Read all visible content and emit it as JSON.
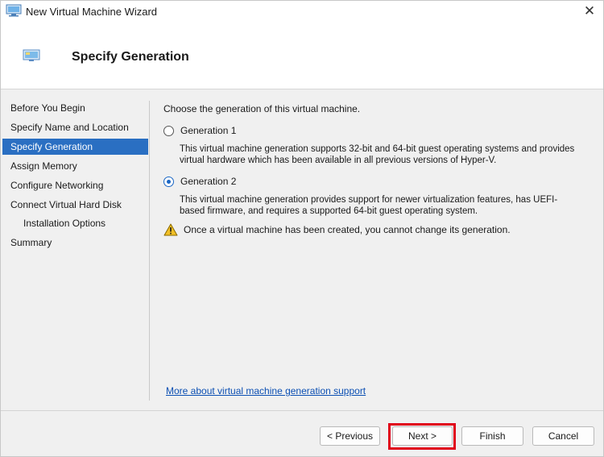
{
  "window": {
    "title": "New Virtual Machine Wizard",
    "close_glyph": "✕",
    "icon": "vm-monitor-icon"
  },
  "header": {
    "title": "Specify Generation",
    "icon": "vm-monitor-icon"
  },
  "nav": {
    "active_index": 2,
    "items": [
      {
        "label": "Before You Begin"
      },
      {
        "label": "Specify Name and Location"
      },
      {
        "label": "Specify Generation"
      },
      {
        "label": "Assign Memory"
      },
      {
        "label": "Configure Networking"
      },
      {
        "label": "Connect Virtual Hard Disk"
      },
      {
        "label": "Installation Options"
      },
      {
        "label": "Summary"
      }
    ]
  },
  "content": {
    "intro": "Choose the generation of this virtual machine.",
    "options": [
      {
        "label": "Generation 1",
        "selected": false,
        "description": "This virtual machine generation supports 32-bit and 64-bit guest operating systems and provides virtual hardware which has been available in all previous versions of Hyper-V."
      },
      {
        "label": "Generation 2",
        "selected": true,
        "description": "This virtual machine generation provides support for newer virtualization features, has UEFI-based firmware, and requires a supported 64-bit guest operating system."
      }
    ],
    "warning": "Once a virtual machine has been created, you cannot change its generation.",
    "more_link": "More about virtual machine generation support"
  },
  "buttons": {
    "previous": "< Previous",
    "next": "Next >",
    "finish": "Finish",
    "cancel": "Cancel"
  },
  "colors": {
    "accent": "#2a6fc2",
    "highlight": "#e0001a",
    "link": "#0b4fb3"
  }
}
